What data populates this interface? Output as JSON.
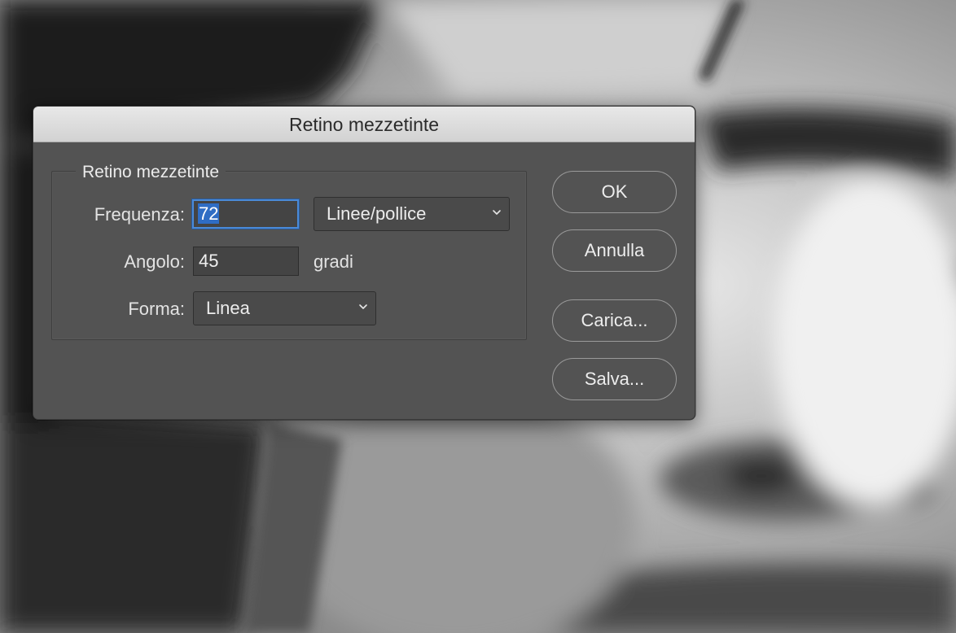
{
  "dialog": {
    "title": "Retino mezzetinte",
    "group_title": "Retino mezzetinte",
    "frequency": {
      "label": "Frequenza:",
      "value": "72",
      "unit_selected": "Linee/pollice"
    },
    "angle": {
      "label": "Angolo:",
      "value": "45",
      "unit": "gradi"
    },
    "shape": {
      "label": "Forma:",
      "selected": "Linea"
    },
    "buttons": {
      "ok": "OK",
      "cancel": "Annulla",
      "load": "Carica...",
      "save": "Salva..."
    }
  },
  "colors": {
    "dialog_bg": "#535353",
    "titlebar_bg": "#dcdcdc",
    "focus_ring": "#4a8ad8",
    "selection": "#2f6dc4"
  },
  "icons": {
    "dropdown": "chevron-down-icon"
  }
}
